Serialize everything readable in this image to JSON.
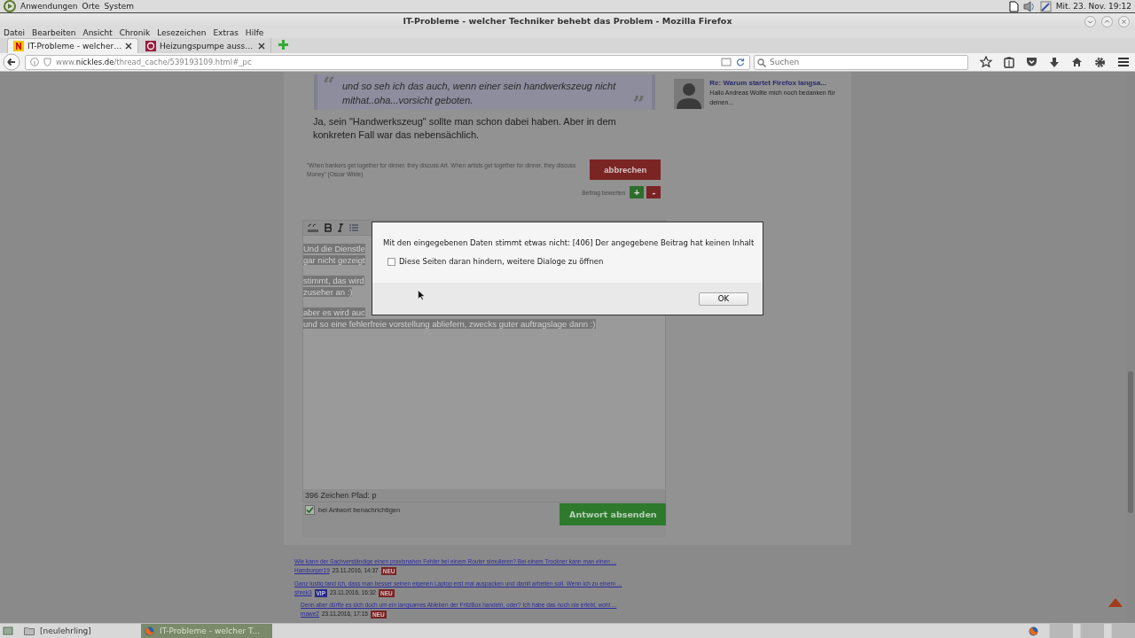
{
  "top_panel": {
    "menus": [
      "Anwendungen",
      "Orte",
      "System"
    ],
    "clock": "Mit. 23. Nov. 19:12"
  },
  "window": {
    "title": "IT-Probleme - welcher Techniker behebt das Problem - Mozilla Firefox"
  },
  "menubar": [
    "Datei",
    "Bearbeiten",
    "Ansicht",
    "Chronik",
    "Lesezeichen",
    "Extras",
    "Hilfe"
  ],
  "tabs": [
    {
      "label": "IT-Probleme - welcher…",
      "selected": true,
      "kind": "n"
    },
    {
      "label": "Heizungspumpe auss…",
      "selected": false,
      "kind": "at"
    }
  ],
  "address": {
    "value": "www.**nickles.de**/thread_cache/539193109.html#_pc"
  },
  "search": {
    "placeholder": "Suchen"
  },
  "quote": {
    "open_mark": "“",
    "text": "und so seh ich das auch, wenn einer sein handwerkszeug nicht mithat..oha...vorsicht geboten.",
    "close_mark": "”"
  },
  "post_text": "Ja, sein \"Handwerkszeug\" sollte man schon dabei haben. Aber in dem konkreten Fall war das nebensächlich.",
  "signature": "\"When bankers get together for dinner, they discuss Art. When artists get together for dinner, they discuss Money\" (Oscar Wilde)",
  "cancel_button": "abbrechen",
  "rating": {
    "label": "Beitrag bewerten",
    "plus": "+",
    "minus": "-"
  },
  "editor": {
    "paragraphs": [
      [
        "Und die Dienstle",
        "gar nicht gezeigt"
      ],
      [
        "stimmt, das wird",
        "zuseher an :)"
      ],
      [
        "aber es wird auc",
        "und so eine fehlerfreie vorstellung abliefern, zwecks guter auftragslage dann :)"
      ]
    ],
    "status": "396 Zeichen Pfad: p"
  },
  "notify": {
    "label": "bei Antwort benachrichtigen",
    "checked": true
  },
  "submit_button": "Antwort absenden",
  "related": [
    {
      "title": "Wie kann der Sachverständige einen praxisnahen Fehler bei einem Router simulieren? Bei einem Trockner kann man einen ...",
      "author": "Hamburger19",
      "date": "23.11.2016, 14:37",
      "badges": [
        {
          "text": "NEU",
          "kind": "new"
        }
      ]
    },
    {
      "title": "Ganz lustig fand ich, dass man besser seinen eigenen Laptop erst mal auspacken und damit arbeiten soll. Wenn ich zu einem ...",
      "author": "shrek3",
      "date": "23.11.2016, 16:32",
      "badges": [
        {
          "text": "VIP",
          "kind": "vip"
        },
        {
          "text": "NEU",
          "kind": "new"
        }
      ],
      "children": [
        {
          "title": "Denn aber dürfte es sich doch um ein langsames Ableben der FritzBox handeln, oder? Ich habe das noch nie erlebt, wohl ...",
          "author": "mawe2",
          "date": "23.11.2016, 17:15",
          "badges": [
            {
              "text": "NEU",
              "kind": "new"
            }
          ]
        }
      ]
    }
  ],
  "sidebar": {
    "title": "Re: Warum startet Firefox langsa...",
    "excerpt": "Hallo Andreas Wollte mich noch bedanken für deinen..."
  },
  "dialog": {
    "message": "Mit den eingegebenen Daten stimmt etwas nicht: [406] Der angegebene Beitrag hat keinen Inhalt",
    "checkbox": {
      "label": "Diese Seiten daran hindern, weitere Dialoge zu öffnen",
      "checked": false
    },
    "button": "OK"
  },
  "taskbar": [
    {
      "label": "[neulehrling]",
      "selected": false,
      "kind": "folder"
    },
    {
      "label": "IT-Probleme - welcher T...",
      "selected": true,
      "kind": "browser"
    }
  ]
}
